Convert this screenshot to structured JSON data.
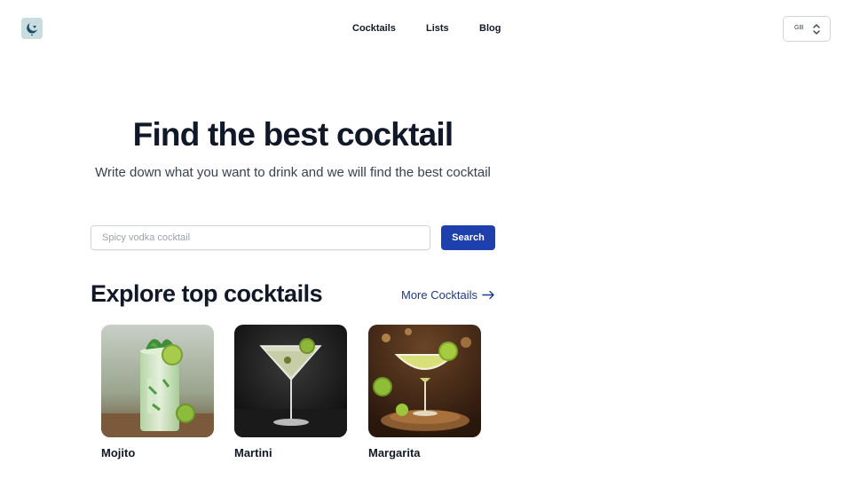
{
  "header": {
    "logo_name": "moon-glass-logo",
    "nav": [
      {
        "label": "Cocktails"
      },
      {
        "label": "Lists"
      },
      {
        "label": "Blog"
      }
    ],
    "language": {
      "value": "GB",
      "icon": "chevron-up-down-icon"
    }
  },
  "hero": {
    "title": "Find the best cocktail",
    "subtitle": "Write down what you want to drink and we will find the best cocktail"
  },
  "search": {
    "placeholder": "Spicy vodka cocktail",
    "value": "",
    "button_label": "Search"
  },
  "explore": {
    "title": "Explore top cocktails",
    "more_label": "More Cocktails",
    "more_icon": "arrow-right-icon",
    "cards": [
      {
        "name": "Mojito"
      },
      {
        "name": "Martini"
      },
      {
        "name": "Margarita"
      }
    ]
  },
  "colors": {
    "primary": "#1e40af",
    "link": "#1e3a8a",
    "text": "#111827",
    "muted": "#374151",
    "border": "#d1d5db"
  }
}
